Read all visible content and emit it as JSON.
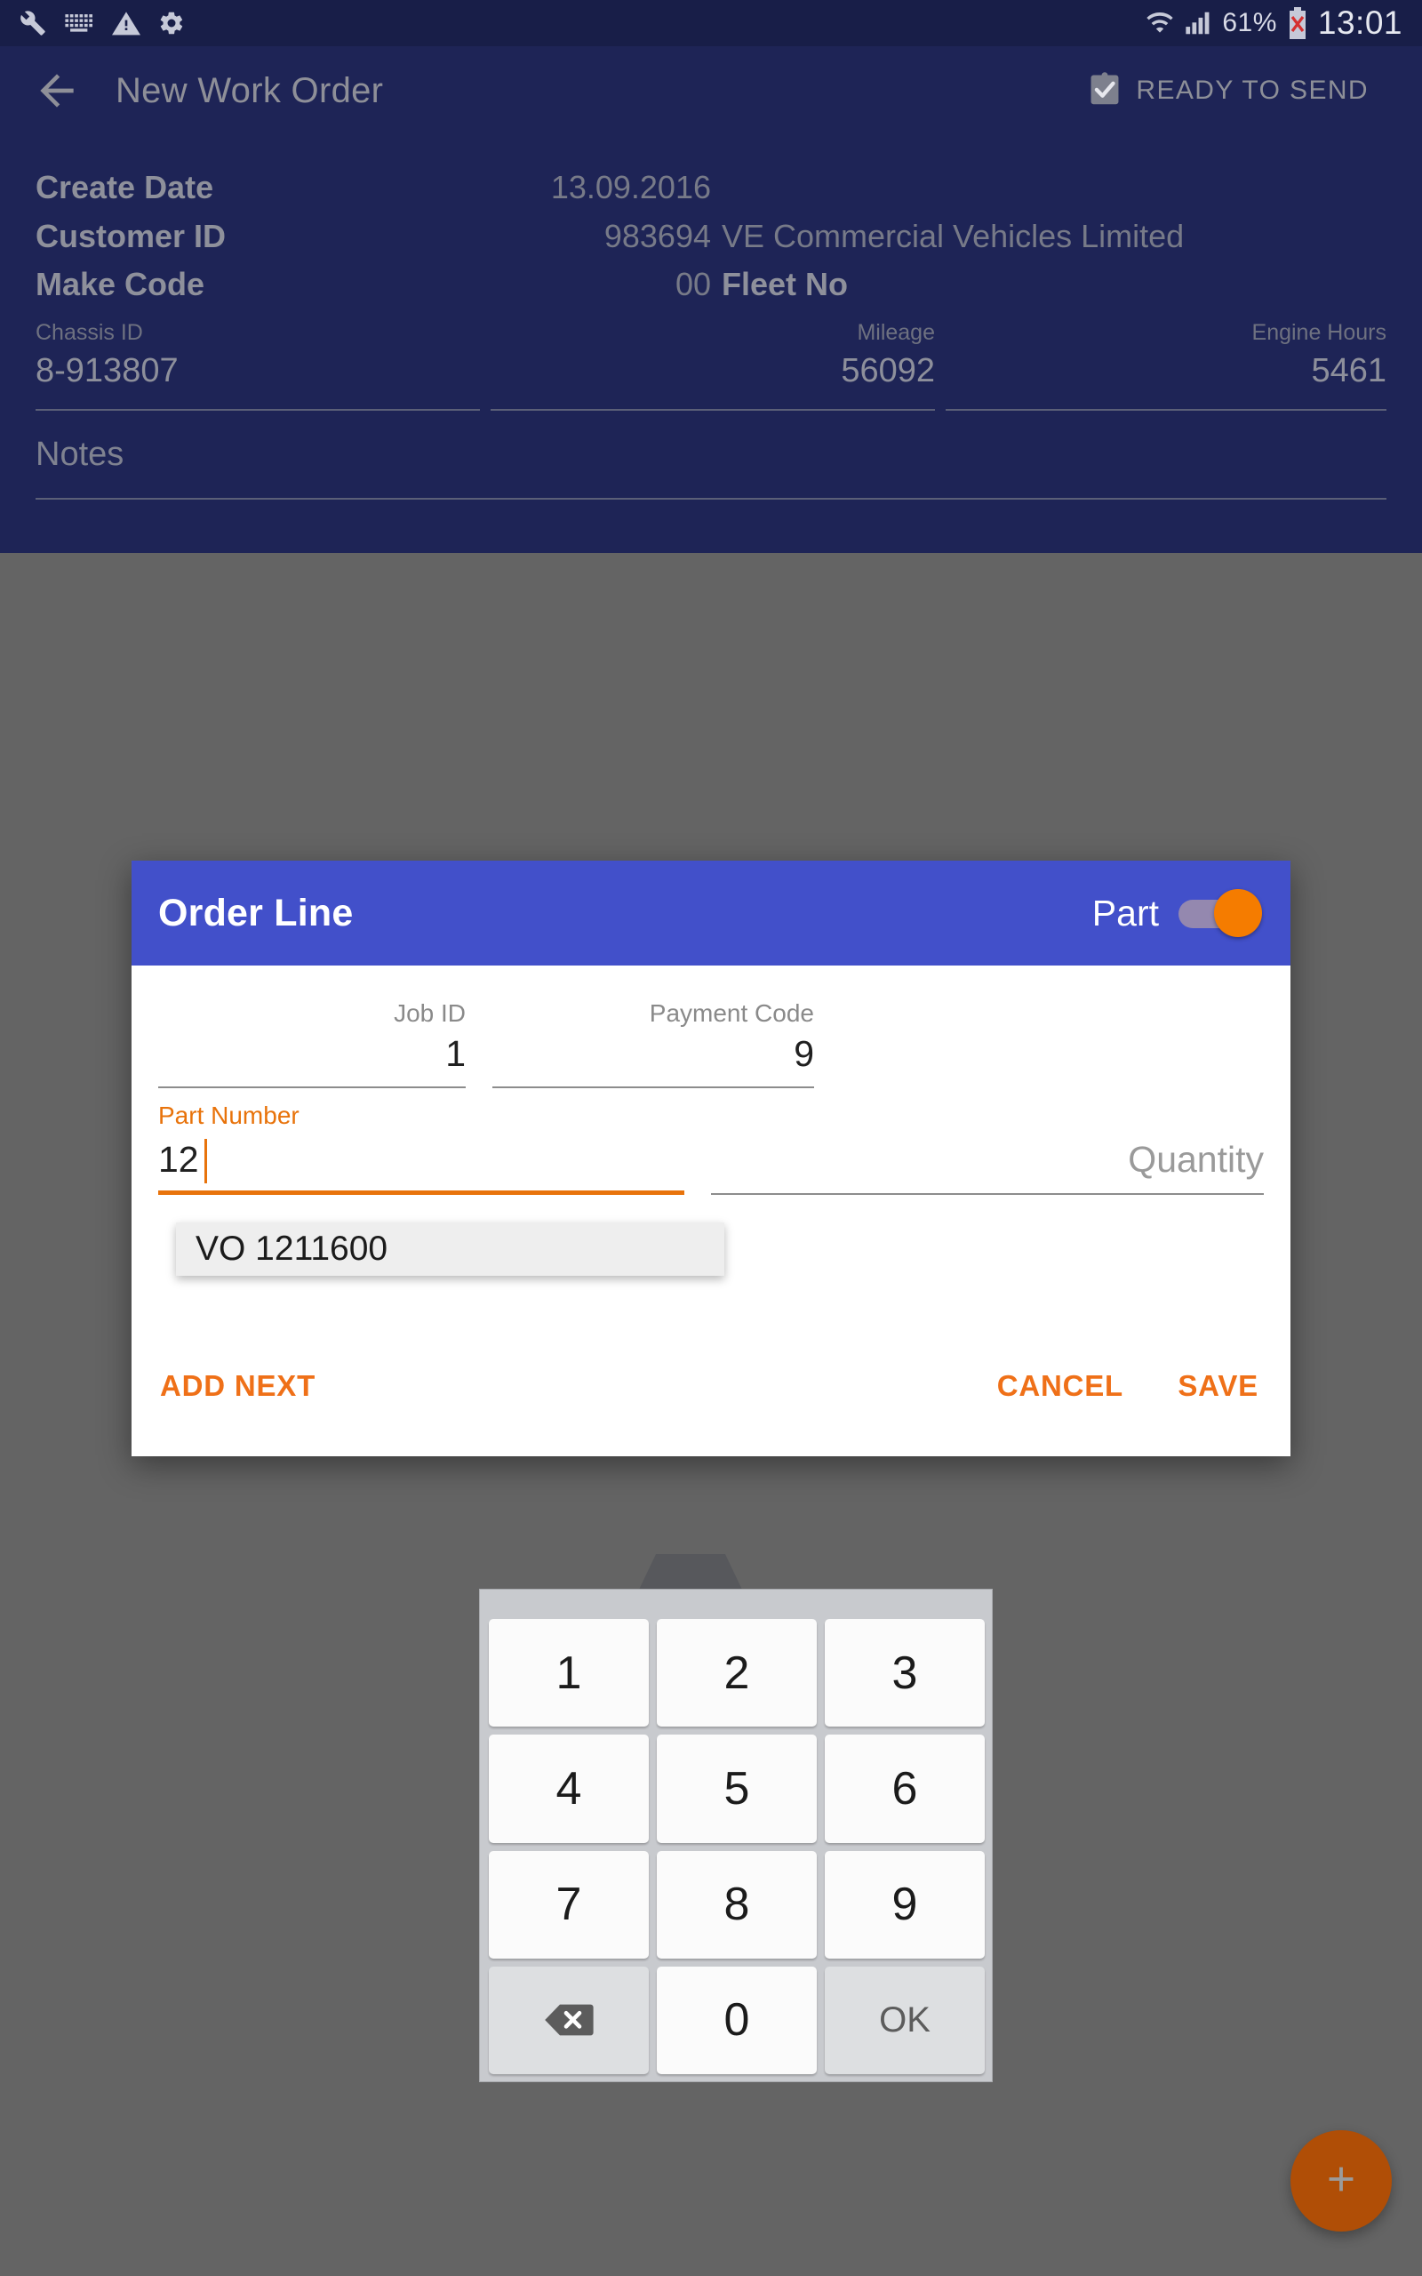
{
  "statusbar": {
    "icons": [
      "wrench-icon",
      "keyboard-icon",
      "warning-icon",
      "gear-icon"
    ],
    "wifi_icon": "wifi-icon",
    "signal_icon": "cellular-signal-icon",
    "battery_percent": "61%",
    "battery_icon": "battery-error-icon",
    "clock": "13:01"
  },
  "appbar": {
    "back_icon": "back-arrow-icon",
    "title": "New Work Order",
    "status_icon": "clipboard-check-icon",
    "status_label": "READY TO SEND"
  },
  "workorder": {
    "rows": [
      {
        "label": "Create Date",
        "value": "13.09.2016",
        "extra": ""
      },
      {
        "label": "Customer ID",
        "value": "983694",
        "extra": "VE Commercial Vehicles Limited"
      },
      {
        "label": "Make Code",
        "value": "00",
        "extra": "Fleet No"
      }
    ],
    "fields": [
      {
        "label": "Chassis ID",
        "value": "8-913807"
      },
      {
        "label": "Mileage",
        "value": "56092"
      },
      {
        "label": "Engine Hours",
        "value": "5461"
      }
    ],
    "notes_label": "Notes",
    "notes_value": ""
  },
  "dialog": {
    "title": "Order Line",
    "toggle_label": "Part",
    "toggle_state": "on",
    "fields": {
      "job_id": {
        "label": "Job ID",
        "value": "1"
      },
      "payment_code": {
        "label": "Payment Code",
        "value": "9"
      },
      "part_number": {
        "label": "Part Number",
        "value": "12",
        "focused": true
      },
      "quantity": {
        "label": "",
        "placeholder": "Quantity",
        "value": ""
      }
    },
    "suggestion": "VO 1211600",
    "actions": {
      "add_next": "ADD NEXT",
      "cancel": "CANCEL",
      "save": "SAVE"
    }
  },
  "keypad": {
    "keys": [
      {
        "label": "1",
        "type": "digit"
      },
      {
        "label": "2",
        "type": "digit"
      },
      {
        "label": "3",
        "type": "digit"
      },
      {
        "label": "4",
        "type": "digit"
      },
      {
        "label": "5",
        "type": "digit"
      },
      {
        "label": "6",
        "type": "digit"
      },
      {
        "label": "7",
        "type": "digit"
      },
      {
        "label": "8",
        "type": "digit"
      },
      {
        "label": "9",
        "type": "digit"
      },
      {
        "label": "",
        "type": "backspace",
        "icon": "backspace-icon"
      },
      {
        "label": "0",
        "type": "digit"
      },
      {
        "label": "OK",
        "type": "func"
      }
    ]
  },
  "fab": {
    "icon": "plus-icon"
  },
  "colors": {
    "app_background": "#1e2456",
    "dialog_header": "#4250ca",
    "accent_orange": "#ef7018",
    "fab": "#b04e06",
    "dim_overlay": "#646464"
  }
}
